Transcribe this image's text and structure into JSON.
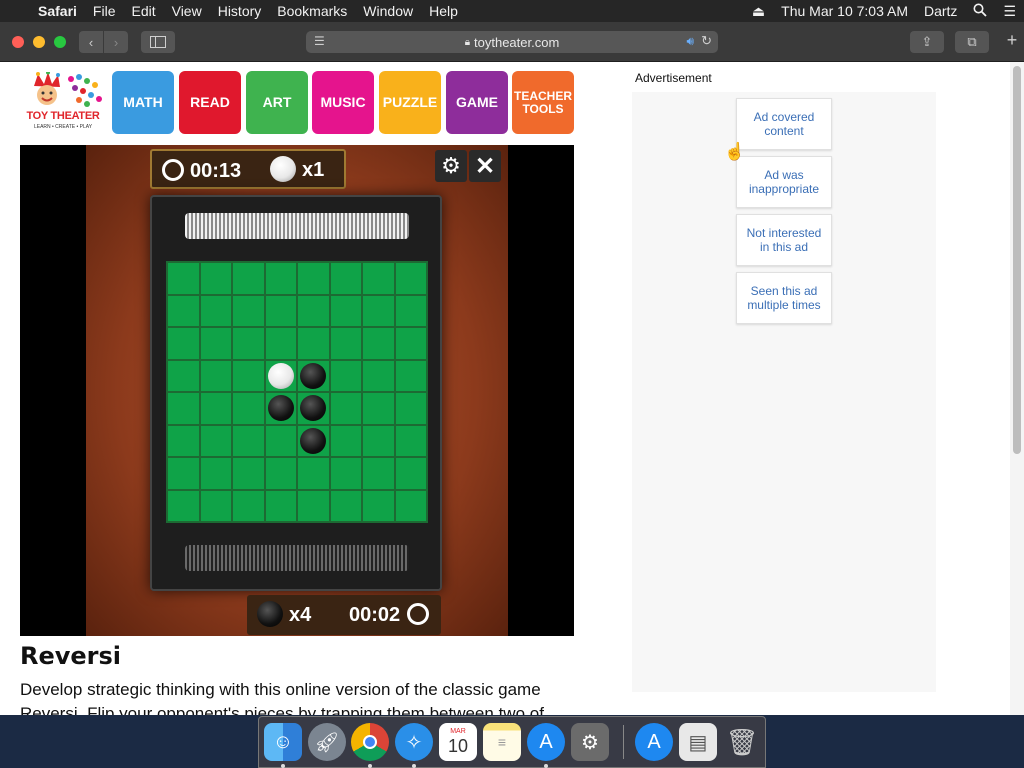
{
  "menubar": {
    "app": "Safari",
    "menus": [
      "File",
      "Edit",
      "View",
      "History",
      "Bookmarks",
      "Window",
      "Help"
    ],
    "datetime": "Thu Mar 10  7:03 AM",
    "user": "Dartz"
  },
  "browser": {
    "url": "toytheater.com"
  },
  "site": {
    "logo_text": "TOY THEATER",
    "logo_tagline": "LEARN • CREATE • PLAY",
    "nav": [
      {
        "label": "MATH",
        "color": "#3a9be0"
      },
      {
        "label": "READ",
        "color": "#e0182d"
      },
      {
        "label": "ART",
        "color": "#3fb34f"
      },
      {
        "label": "MUSIC",
        "color": "#e5148d"
      },
      {
        "label": "PUZZLE",
        "color": "#f9b11b"
      },
      {
        "label": "GAME",
        "color": "#8e2d9b"
      },
      {
        "label": "TEACHER TOOLS",
        "color": "#f06a2c"
      }
    ]
  },
  "game": {
    "top_timer": "00:13",
    "top_count": "x1",
    "top_color": "white",
    "bottom_count": "x4",
    "bottom_timer": "00:02",
    "bottom_color": "black",
    "board": [
      {
        "row": 3,
        "col": 3,
        "color": "white"
      },
      {
        "row": 3,
        "col": 4,
        "color": "black"
      },
      {
        "row": 4,
        "col": 3,
        "color": "black"
      },
      {
        "row": 4,
        "col": 4,
        "color": "black"
      },
      {
        "row": 5,
        "col": 4,
        "color": "black"
      }
    ]
  },
  "content": {
    "title": "Reversi",
    "description": "Develop strategic thinking with this online version of the classic game Reversi.  Flip your opponent's pieces by trapping them between two of"
  },
  "ad": {
    "label": "Advertisement",
    "options": [
      "Ad covered content",
      "Ad was inappropriate",
      "Not interested in this ad",
      "Seen this ad multiple times"
    ]
  },
  "dock": {
    "calendar_month": "MAR",
    "calendar_day": "10",
    "apps": [
      "finder",
      "launchpad",
      "chrome",
      "safari",
      "calendar",
      "notes",
      "app-store",
      "system-preferences",
      "app-store-downloads",
      "documents",
      "trash"
    ]
  }
}
